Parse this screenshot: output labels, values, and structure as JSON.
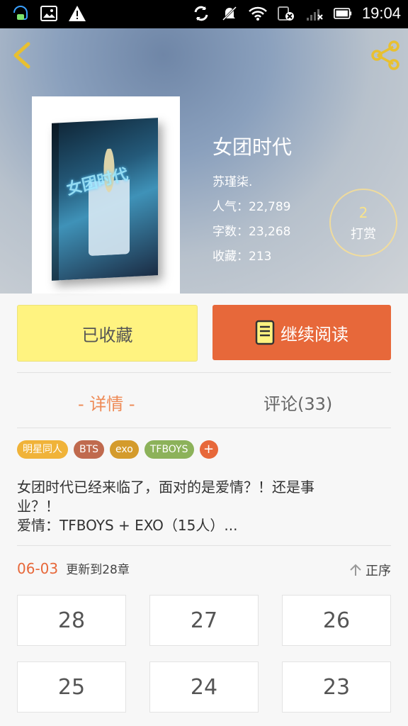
{
  "status_bar": {
    "time": "19:04"
  },
  "book": {
    "title": "女团时代",
    "author": "苏瑾柒.",
    "popularity": "人气：22,789",
    "word_count": "字数：23,268",
    "favorites": "收藏：213",
    "cover_art_text": "女团时代"
  },
  "tip": {
    "count": "2",
    "label": "打赏"
  },
  "buttons": {
    "favorited": "已收藏",
    "continue_reading": "继续阅读"
  },
  "tabs": {
    "detail": "- 详情 -",
    "comments": "评论(33)"
  },
  "tags": [
    {
      "label": "明星同人",
      "color": "#f0b339"
    },
    {
      "label": "BTS",
      "color": "#c06a4e"
    },
    {
      "label": "exo",
      "color": "#d49b2c"
    },
    {
      "label": "TFBOYS",
      "color": "#8cb25a"
    },
    {
      "label": "+",
      "color": "#e7683a"
    }
  ],
  "description": {
    "line1": "女团时代已经来临了，面对的是爱情？！还是事",
    "line2": "业？！",
    "line3": "爱情：TFBOYS + EXO（15人）..."
  },
  "update": {
    "date": "06-03",
    "text": "更新到28章",
    "sort_label": "正序"
  },
  "chapters": [
    "28",
    "27",
    "26",
    "25",
    "24",
    "23"
  ],
  "colors": {
    "accent": "#e7683a",
    "favorite_button": "#fff380"
  }
}
